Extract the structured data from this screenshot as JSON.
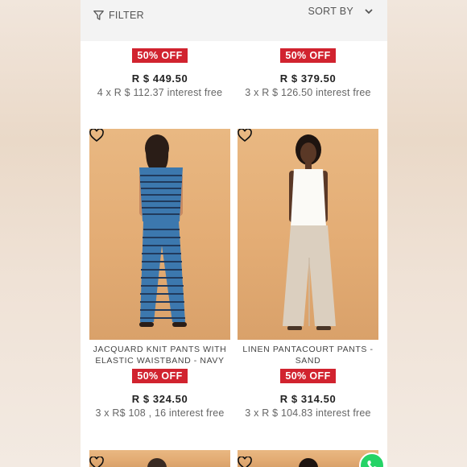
{
  "toolbar": {
    "filter_label": "FILTER",
    "sort_label": "SORT BY"
  },
  "products_top": [
    {
      "badge": "50% OFF",
      "price": "R $ 449.50",
      "installments": "4 x R $ 112.37 interest free"
    },
    {
      "badge": "50% OFF",
      "price": "R $ 379.50",
      "installments": "3 x R $ 126.50 interest free"
    }
  ],
  "products_middle": [
    {
      "title": "JACQUARD KNIT PANTS WITH ELASTIC WAISTBAND - NAVY",
      "badge": "50% OFF",
      "price": "R $ 324.50",
      "installments": "3 x R$ 108 , 16  interest free"
    },
    {
      "title": "LINEN PANTACOURT PANTS - SAND",
      "badge": "50% OFF",
      "price": "R $ 314.50",
      "installments": "3 x R $ 104.83 interest free"
    }
  ],
  "icons": {
    "filter": "filter-icon",
    "sort": "chevron-down-icon",
    "favorite": "heart-outline-icon",
    "chat": "whatsapp-icon"
  },
  "colors": {
    "badge_bg": "#d1232f",
    "photo_bg": "#e3ac74",
    "whatsapp": "#25d366"
  }
}
